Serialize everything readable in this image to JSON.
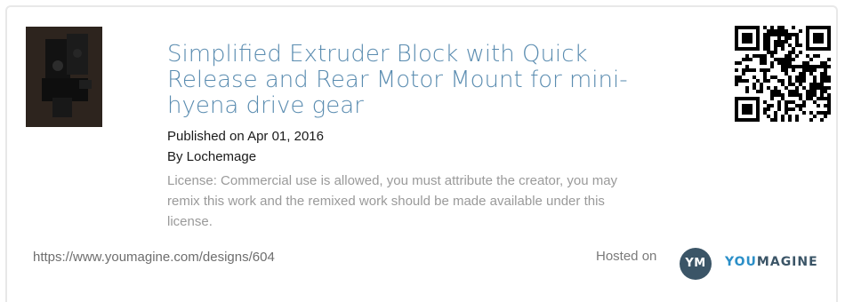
{
  "design": {
    "title": "Simplified Extruder Block with Quick Release and Rear Motor Mount for mini-hyena drive gear",
    "published": "Published on Apr 01, 2016",
    "author": "By Lochemage",
    "license": "License: Commercial use is allowed, you must attribute the creator, you may remix this work and the remixed work should be made available under this license.",
    "url": "https://www.youmagine.com/designs/604"
  },
  "footer": {
    "hosted_label": "Hosted on",
    "badge_text": "YM",
    "brand_part1": "YOU",
    "brand_part2": "MAGINE"
  },
  "colors": {
    "title": "#5a8cb0",
    "brand_you": "#2b8fc8",
    "brand_magine": "#3b5567",
    "badge_bg": "#3b5567",
    "license_text": "#9a9a9a"
  },
  "icons": {
    "thumbnail": "extruder-block-photo",
    "qr": "qr-code-icon"
  }
}
